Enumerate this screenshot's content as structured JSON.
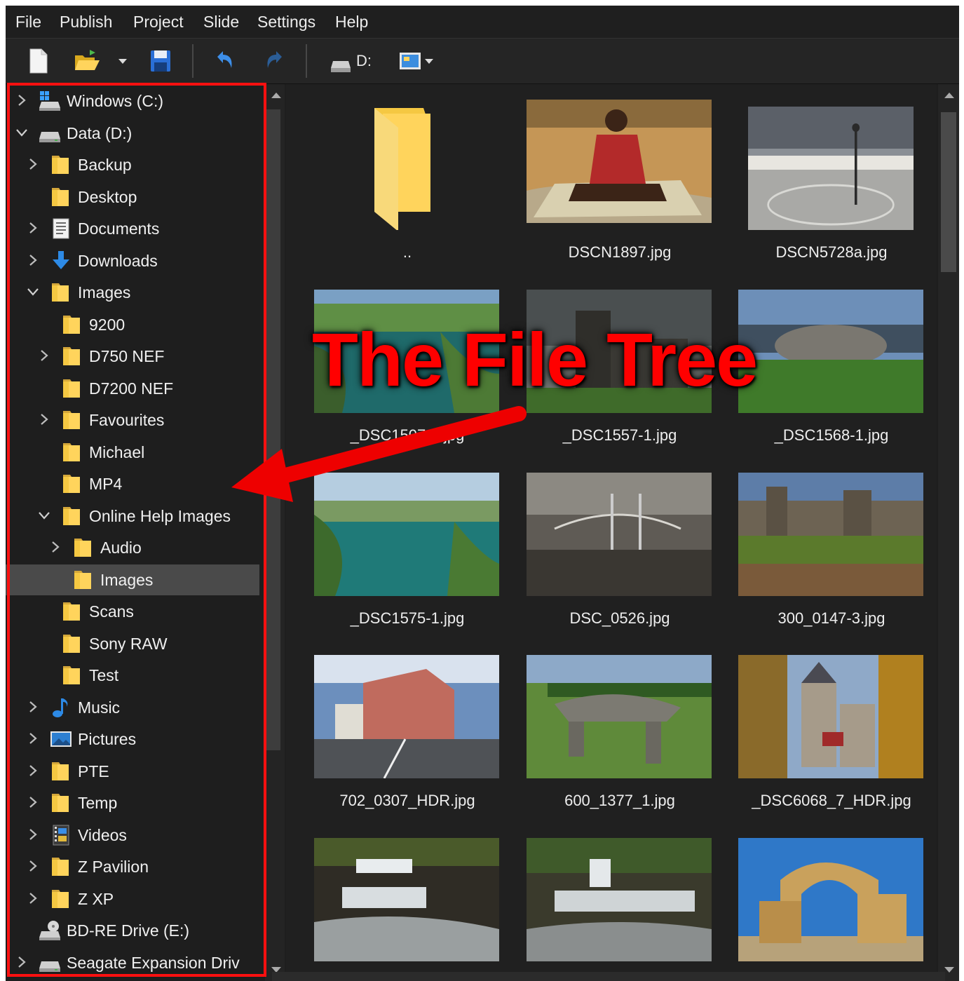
{
  "menu": [
    "File",
    "Publish",
    "Project",
    "Slide",
    "Settings",
    "Help"
  ],
  "toolbar": {
    "new_icon": "new-file-icon",
    "open_icon": "open-folder-icon",
    "save_icon": "save-disk-icon",
    "undo_icon": "undo-icon",
    "redo_icon": "redo-icon",
    "drive_label": "D:",
    "view_icon": "view-mode-icon"
  },
  "tree": [
    {
      "label": "Windows (C:)",
      "icon": "windows-drive-icon",
      "expander": "collapsed",
      "depth": 0
    },
    {
      "label": "Data (D:)",
      "icon": "drive-icon",
      "expander": "expanded",
      "depth": 0
    },
    {
      "label": "Backup",
      "icon": "folder-icon",
      "expander": "collapsed",
      "depth": 1
    },
    {
      "label": "Desktop",
      "icon": "folder-icon",
      "expander": "none",
      "depth": 1
    },
    {
      "label": "Documents",
      "icon": "documents-icon",
      "expander": "collapsed",
      "depth": 1
    },
    {
      "label": "Downloads",
      "icon": "downloads-icon",
      "expander": "collapsed",
      "depth": 1
    },
    {
      "label": "Images",
      "icon": "folder-icon",
      "expander": "expanded",
      "depth": 1
    },
    {
      "label": "9200",
      "icon": "folder-icon",
      "expander": "none",
      "depth": 2
    },
    {
      "label": "D750 NEF",
      "icon": "folder-icon",
      "expander": "collapsed",
      "depth": 2
    },
    {
      "label": "D7200 NEF",
      "icon": "folder-icon",
      "expander": "none",
      "depth": 2
    },
    {
      "label": "Favourites",
      "icon": "folder-icon",
      "expander": "collapsed",
      "depth": 2
    },
    {
      "label": "Michael",
      "icon": "folder-icon",
      "expander": "none",
      "depth": 2
    },
    {
      "label": "MP4",
      "icon": "folder-icon",
      "expander": "none",
      "depth": 2
    },
    {
      "label": "Online Help Images",
      "icon": "folder-icon",
      "expander": "expanded",
      "depth": 2
    },
    {
      "label": "Audio",
      "icon": "folder-icon",
      "expander": "collapsed",
      "depth": 3
    },
    {
      "label": "Images",
      "icon": "folder-icon",
      "expander": "none",
      "depth": 3,
      "selected": true
    },
    {
      "label": "Scans",
      "icon": "folder-icon",
      "expander": "none",
      "depth": 2
    },
    {
      "label": "Sony RAW",
      "icon": "folder-icon",
      "expander": "none",
      "depth": 2
    },
    {
      "label": "Test",
      "icon": "folder-icon",
      "expander": "none",
      "depth": 2
    },
    {
      "label": "Music",
      "icon": "music-icon",
      "expander": "collapsed",
      "depth": 1
    },
    {
      "label": "Pictures",
      "icon": "pictures-icon",
      "expander": "collapsed",
      "depth": 1
    },
    {
      "label": "PTE",
      "icon": "folder-icon",
      "expander": "collapsed",
      "depth": 1
    },
    {
      "label": "Temp",
      "icon": "folder-icon",
      "expander": "collapsed",
      "depth": 1
    },
    {
      "label": "Videos",
      "icon": "videos-icon",
      "expander": "collapsed",
      "depth": 1
    },
    {
      "label": "Z Pavilion",
      "icon": "folder-icon",
      "expander": "collapsed",
      "depth": 1
    },
    {
      "label": "Z XP",
      "icon": "folder-icon",
      "expander": "collapsed",
      "depth": 1
    },
    {
      "label": "BD-RE Drive (E:)",
      "icon": "optical-drive-icon",
      "expander": "none",
      "depth": 0
    },
    {
      "label": "Seagate Expansion Driv",
      "icon": "drive-icon",
      "expander": "collapsed",
      "depth": 0
    }
  ],
  "files": [
    {
      "name": "..",
      "kind": "parent-folder"
    },
    {
      "name": "DSCN1897.jpg",
      "kind": "photo",
      "scene": "person-seated"
    },
    {
      "name": "DSCN5728a.jpg",
      "kind": "photo",
      "scene": "plaza"
    },
    {
      "name": "_DSC1507-1.jpg",
      "kind": "photo",
      "scene": "coast"
    },
    {
      "name": "_DSC1557-1.jpg",
      "kind": "photo",
      "scene": "church"
    },
    {
      "name": "_DSC1568-1.jpg",
      "kind": "photo",
      "scene": "stone"
    },
    {
      "name": "_DSC1575-1.jpg",
      "kind": "photo",
      "scene": "inlet"
    },
    {
      "name": "DSC_0526.jpg",
      "kind": "photo",
      "scene": "bridge"
    },
    {
      "name": "300_0147-3.jpg",
      "kind": "photo",
      "scene": "castle"
    },
    {
      "name": "702_0307_HDR.jpg",
      "kind": "photo",
      "scene": "building"
    },
    {
      "name": "600_1377_1.jpg",
      "kind": "photo",
      "scene": "dolmen"
    },
    {
      "name": "_DSC6068_7_HDR.jpg",
      "kind": "photo",
      "scene": "castle2"
    },
    {
      "name": "",
      "kind": "photo",
      "scene": "waterfall"
    },
    {
      "name": "",
      "kind": "photo",
      "scene": "waterfall2"
    },
    {
      "name": "",
      "kind": "photo",
      "scene": "ruins"
    }
  ],
  "overlay": {
    "title": "The File Tree",
    "color": "#ff0000"
  },
  "colors": {
    "background": "#1e1e1e",
    "selected_row": "#4a4a4a",
    "folder": "#ffd45c",
    "accent_blue": "#2d8ae6"
  }
}
